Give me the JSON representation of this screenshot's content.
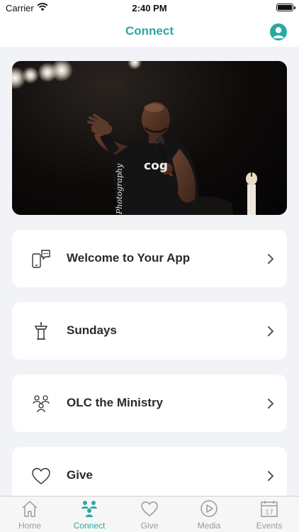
{
  "status_bar": {
    "carrier": "Carrier",
    "time": "2:40 PM"
  },
  "nav": {
    "title": "Connect"
  },
  "hero": {
    "watermark": "Photography",
    "shirt_text": "cog"
  },
  "cards": [
    {
      "label": "Welcome to Your App",
      "icon": "chat-phone-icon"
    },
    {
      "label": "Sundays",
      "icon": "podium-icon"
    },
    {
      "label": "OLC the Ministry",
      "icon": "people-group-icon"
    },
    {
      "label": "Give",
      "icon": "heart-icon"
    }
  ],
  "tabs": [
    {
      "label": "Home",
      "icon": "home-icon",
      "active": false
    },
    {
      "label": "Connect",
      "icon": "connect-icon",
      "active": true
    },
    {
      "label": "Give",
      "icon": "heart-icon",
      "active": false
    },
    {
      "label": "Media",
      "icon": "play-icon",
      "active": false
    },
    {
      "label": "Events",
      "icon": "calendar-icon",
      "active": false,
      "badge": "17"
    }
  ],
  "colors": {
    "accent": "#2ba7a3",
    "background": "#f2f3f7",
    "inactive_tab": "#9a9a9a"
  }
}
